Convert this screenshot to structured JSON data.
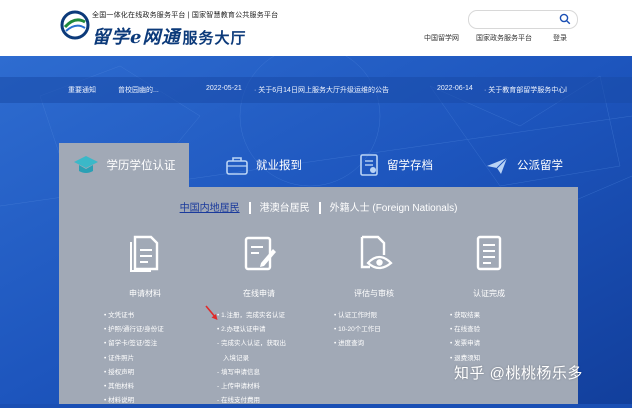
{
  "colors": {
    "brand_blue": "#1a4fb4",
    "panel_gray": "#a1a9b6",
    "accent_red": "#e02a2a"
  },
  "header": {
    "platform_line": "全国一体化在线政务服务平台 | 国家智慧教育公共服务平台",
    "logo_script": "留学",
    "logo_e": "e",
    "logo_script2": "网通",
    "logo_hall": "服务大厅",
    "search": {
      "placeholder": "",
      "icon": "search-icon"
    },
    "nav": [
      "中国留学网",
      "国家政务服务平台",
      "登录"
    ]
  },
  "notice": {
    "label": "重要通知",
    "item1": "曾校园幽的...",
    "date1": "2022-05-21",
    "item2": "· 关于6月14日网上服务大厅升级运维的公告",
    "date2": "2022-06-14",
    "item3": "· 关于教育部留学服务中心l"
  },
  "tabs": [
    {
      "label": "学历学位认证",
      "icon": "graduation-cap-icon",
      "active": true
    },
    {
      "label": "就业报到",
      "icon": "briefcase-icon",
      "active": false
    },
    {
      "label": "留学存档",
      "icon": "archive-icon",
      "active": false
    },
    {
      "label": "公派留学",
      "icon": "plane-icon",
      "active": false
    }
  ],
  "residence": {
    "options": [
      "中国内地居民",
      "港澳台居民",
      "外籍人士 (Foreign Nationals)"
    ],
    "selected": "中国内地居民"
  },
  "steps": [
    {
      "label": "申请材料",
      "icon": "document-icon"
    },
    {
      "label": "在线申请",
      "icon": "edit-form-icon"
    },
    {
      "label": "评估与审核",
      "icon": "review-eye-icon"
    },
    {
      "label": "认证完成",
      "icon": "checklist-icon"
    }
  ],
  "columns": {
    "materials": [
      "• 文凭证书",
      "• 护照/通行证/身份证",
      "• 留学卡/签证/签注",
      "• 证件照片",
      "• 授权声明",
      "• 其他材料",
      "• 材料说明"
    ],
    "apply": [
      "• 1.注册，完成实名认证",
      "• 2.办理认证申请",
      "- 完成实人认证，获取出",
      "入境记录",
      "- 填写申请信息",
      "- 上传申请材料",
      "- 在线支付费用"
    ],
    "review": [
      "• 认证工作时限",
      "• 10-20个工作日",
      "• 进度查询"
    ],
    "complete": [
      "• 获取结果",
      "• 在线查验",
      "• 发票申请",
      "• 退费须知"
    ]
  },
  "watermark": "知乎 @桃桃杨乐多"
}
